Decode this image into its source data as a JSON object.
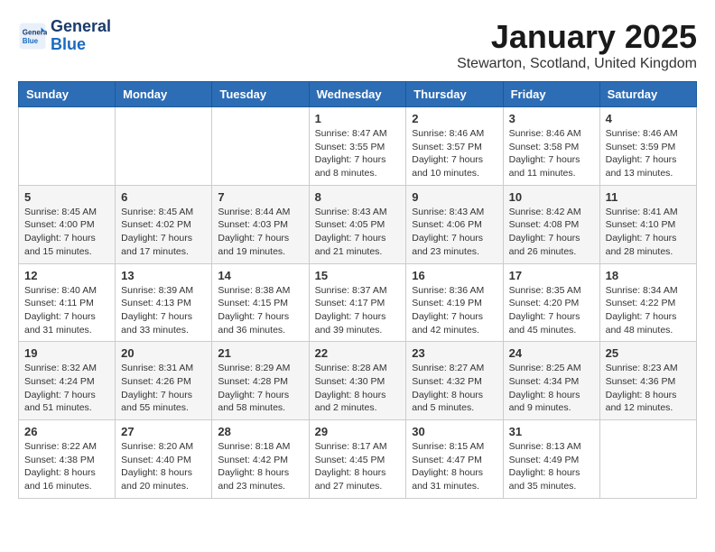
{
  "header": {
    "logo_line1": "General",
    "logo_line2": "Blue",
    "month": "January 2025",
    "location": "Stewarton, Scotland, United Kingdom"
  },
  "columns": [
    "Sunday",
    "Monday",
    "Tuesday",
    "Wednesday",
    "Thursday",
    "Friday",
    "Saturday"
  ],
  "weeks": [
    [
      {
        "day": "",
        "info": ""
      },
      {
        "day": "",
        "info": ""
      },
      {
        "day": "",
        "info": ""
      },
      {
        "day": "1",
        "info": "Sunrise: 8:47 AM\nSunset: 3:55 PM\nDaylight: 7 hours and 8 minutes."
      },
      {
        "day": "2",
        "info": "Sunrise: 8:46 AM\nSunset: 3:57 PM\nDaylight: 7 hours and 10 minutes."
      },
      {
        "day": "3",
        "info": "Sunrise: 8:46 AM\nSunset: 3:58 PM\nDaylight: 7 hours and 11 minutes."
      },
      {
        "day": "4",
        "info": "Sunrise: 8:46 AM\nSunset: 3:59 PM\nDaylight: 7 hours and 13 minutes."
      }
    ],
    [
      {
        "day": "5",
        "info": "Sunrise: 8:45 AM\nSunset: 4:00 PM\nDaylight: 7 hours and 15 minutes."
      },
      {
        "day": "6",
        "info": "Sunrise: 8:45 AM\nSunset: 4:02 PM\nDaylight: 7 hours and 17 minutes."
      },
      {
        "day": "7",
        "info": "Sunrise: 8:44 AM\nSunset: 4:03 PM\nDaylight: 7 hours and 19 minutes."
      },
      {
        "day": "8",
        "info": "Sunrise: 8:43 AM\nSunset: 4:05 PM\nDaylight: 7 hours and 21 minutes."
      },
      {
        "day": "9",
        "info": "Sunrise: 8:43 AM\nSunset: 4:06 PM\nDaylight: 7 hours and 23 minutes."
      },
      {
        "day": "10",
        "info": "Sunrise: 8:42 AM\nSunset: 4:08 PM\nDaylight: 7 hours and 26 minutes."
      },
      {
        "day": "11",
        "info": "Sunrise: 8:41 AM\nSunset: 4:10 PM\nDaylight: 7 hours and 28 minutes."
      }
    ],
    [
      {
        "day": "12",
        "info": "Sunrise: 8:40 AM\nSunset: 4:11 PM\nDaylight: 7 hours and 31 minutes."
      },
      {
        "day": "13",
        "info": "Sunrise: 8:39 AM\nSunset: 4:13 PM\nDaylight: 7 hours and 33 minutes."
      },
      {
        "day": "14",
        "info": "Sunrise: 8:38 AM\nSunset: 4:15 PM\nDaylight: 7 hours and 36 minutes."
      },
      {
        "day": "15",
        "info": "Sunrise: 8:37 AM\nSunset: 4:17 PM\nDaylight: 7 hours and 39 minutes."
      },
      {
        "day": "16",
        "info": "Sunrise: 8:36 AM\nSunset: 4:19 PM\nDaylight: 7 hours and 42 minutes."
      },
      {
        "day": "17",
        "info": "Sunrise: 8:35 AM\nSunset: 4:20 PM\nDaylight: 7 hours and 45 minutes."
      },
      {
        "day": "18",
        "info": "Sunrise: 8:34 AM\nSunset: 4:22 PM\nDaylight: 7 hours and 48 minutes."
      }
    ],
    [
      {
        "day": "19",
        "info": "Sunrise: 8:32 AM\nSunset: 4:24 PM\nDaylight: 7 hours and 51 minutes."
      },
      {
        "day": "20",
        "info": "Sunrise: 8:31 AM\nSunset: 4:26 PM\nDaylight: 7 hours and 55 minutes."
      },
      {
        "day": "21",
        "info": "Sunrise: 8:29 AM\nSunset: 4:28 PM\nDaylight: 7 hours and 58 minutes."
      },
      {
        "day": "22",
        "info": "Sunrise: 8:28 AM\nSunset: 4:30 PM\nDaylight: 8 hours and 2 minutes."
      },
      {
        "day": "23",
        "info": "Sunrise: 8:27 AM\nSunset: 4:32 PM\nDaylight: 8 hours and 5 minutes."
      },
      {
        "day": "24",
        "info": "Sunrise: 8:25 AM\nSunset: 4:34 PM\nDaylight: 8 hours and 9 minutes."
      },
      {
        "day": "25",
        "info": "Sunrise: 8:23 AM\nSunset: 4:36 PM\nDaylight: 8 hours and 12 minutes."
      }
    ],
    [
      {
        "day": "26",
        "info": "Sunrise: 8:22 AM\nSunset: 4:38 PM\nDaylight: 8 hours and 16 minutes."
      },
      {
        "day": "27",
        "info": "Sunrise: 8:20 AM\nSunset: 4:40 PM\nDaylight: 8 hours and 20 minutes."
      },
      {
        "day": "28",
        "info": "Sunrise: 8:18 AM\nSunset: 4:42 PM\nDaylight: 8 hours and 23 minutes."
      },
      {
        "day": "29",
        "info": "Sunrise: 8:17 AM\nSunset: 4:45 PM\nDaylight: 8 hours and 27 minutes."
      },
      {
        "day": "30",
        "info": "Sunrise: 8:15 AM\nSunset: 4:47 PM\nDaylight: 8 hours and 31 minutes."
      },
      {
        "day": "31",
        "info": "Sunrise: 8:13 AM\nSunset: 4:49 PM\nDaylight: 8 hours and 35 minutes."
      },
      {
        "day": "",
        "info": ""
      }
    ]
  ]
}
